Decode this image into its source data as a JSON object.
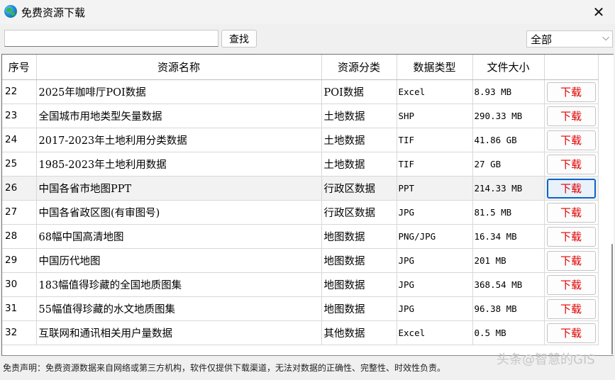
{
  "window": {
    "title": "免费资源下载",
    "close_glyph": "✕"
  },
  "toolbar": {
    "search_value": "",
    "search_label": "查找",
    "filter_value": "全部"
  },
  "table": {
    "headers": [
      "序号",
      "资源名称",
      "资源分类",
      "数据类型",
      "文件大小",
      ""
    ],
    "download_label": "下载",
    "rows": [
      {
        "idx": "22",
        "name": "2025年咖啡厅POI数据",
        "cat": "POI数据",
        "type": "Excel",
        "size": "8.93 MB"
      },
      {
        "idx": "23",
        "name": "全国城市用地类型矢量数据",
        "cat": "土地数据",
        "type": "SHP",
        "size": "290.33 MB"
      },
      {
        "idx": "24",
        "name": "2017-2023年土地利用分类数据",
        "cat": "土地数据",
        "type": "TIF",
        "size": "41.86 GB"
      },
      {
        "idx": "25",
        "name": "1985-2023年土地利用数据",
        "cat": "土地数据",
        "type": "TIF",
        "size": "27 GB"
      },
      {
        "idx": "26",
        "name": "中国各省市地图PPT",
        "cat": "行政区数据",
        "type": "PPT",
        "size": "214.33 MB"
      },
      {
        "idx": "27",
        "name": "中国各省政区图(有审图号)",
        "cat": "行政区数据",
        "type": "JPG",
        "size": "81.5 MB"
      },
      {
        "idx": "28",
        "name": "68幅中国高清地图",
        "cat": "地图数据",
        "type": "PNG/JPG",
        "size": "16.34 MB"
      },
      {
        "idx": "29",
        "name": "中国历代地图",
        "cat": "地图数据",
        "type": "JPG",
        "size": "201 MB"
      },
      {
        "idx": "30",
        "name": "183幅值得珍藏的全国地质图集",
        "cat": "地图数据",
        "type": "JPG",
        "size": "368.54 MB"
      },
      {
        "idx": "31",
        "name": "55幅值得珍藏的水文地质图集",
        "cat": "地图数据",
        "type": "JPG",
        "size": "96.38 MB"
      },
      {
        "idx": "32",
        "name": "互联网和通讯相关用户量数据",
        "cat": "其他数据",
        "type": "Excel",
        "size": "0.5 MB"
      }
    ],
    "selected_row": "26"
  },
  "footer": {
    "disclaimer": "免责声明：免费资源数据来自网络或第三方机构，软件仅提供下载渠道，无法对数据的正确性、完整性、时效性负责。"
  },
  "watermark": "头条@智慧的GIS",
  "colors": {
    "download_text": "#e00000",
    "focus_border": "#0a64c8"
  }
}
